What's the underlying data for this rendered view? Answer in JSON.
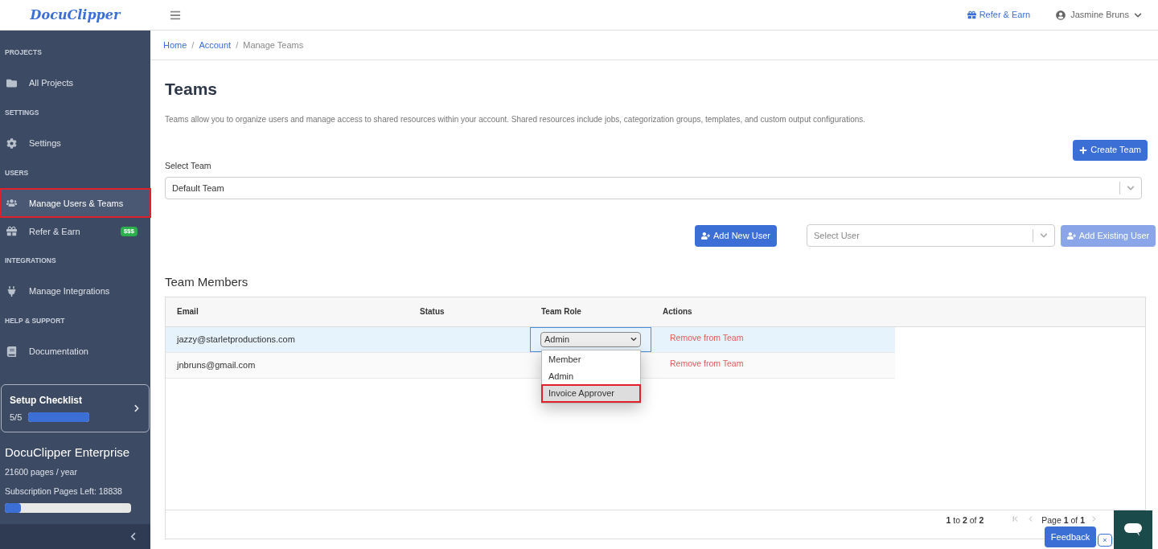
{
  "header": {
    "logo": "DocuClipper",
    "refer_link": "Refer & Earn",
    "user_name": "Jasmine Bruns"
  },
  "sidebar": {
    "sections": [
      {
        "label": "PROJECTS",
        "items": [
          {
            "label": "All Projects",
            "selected": false,
            "outlined": false
          }
        ]
      },
      {
        "label": "SETTINGS",
        "items": [
          {
            "label": "Settings",
            "selected": false,
            "outlined": false
          }
        ]
      },
      {
        "label": "USERS",
        "items": [
          {
            "label": "Manage Users & Teams",
            "selected": true,
            "outlined": true
          },
          {
            "label": "Refer & Earn",
            "selected": false,
            "outlined": false,
            "badge": "$$$"
          }
        ]
      },
      {
        "label": "INTEGRATIONS",
        "items": [
          {
            "label": "Manage Integrations",
            "selected": false,
            "outlined": false
          }
        ]
      },
      {
        "label": "HELP & SUPPORT",
        "items": [
          {
            "label": "Documentation",
            "selected": false,
            "outlined": false
          }
        ]
      }
    ],
    "checklist": {
      "title": "Setup Checklist",
      "count": "5/5",
      "level": 1
    },
    "plan": {
      "name": "DocuClipper Enterprise",
      "pages": "21600 pages / year",
      "left": "Subscription Pages Left: 18838",
      "level": 0.13
    }
  },
  "breadcrumb": [
    {
      "label": "Home",
      "link": true
    },
    {
      "label": "/",
      "separator": true
    },
    {
      "label": "Account",
      "link": true
    },
    {
      "label": "/",
      "separator": true
    },
    {
      "label": "Manage Teams",
      "link": false
    }
  ],
  "page": {
    "title": "Teams",
    "description": "Teams allow you to organize users and manage access to shared resources within your account. Shared resources include jobs, categorization groups, templates, and custom output configurations.",
    "create_button": "Create Team",
    "select_label": "Select Team",
    "select_value": "Default Team",
    "add_new_button": "Add New User",
    "user_select_placeholder": "Select User",
    "add_existing_button": {
      "label": "Add Existing User",
      "disabled": true
    }
  },
  "table": {
    "title": "Team Members",
    "columns": [
      "Email",
      "Status",
      "Team Role",
      "Actions"
    ],
    "rows": [
      {
        "email": "jazzy@starletproductions.com",
        "role": "Admin",
        "action": "Remove from Team",
        "selected": true
      },
      {
        "email": "jnbruns@gmail.com",
        "action": "Remove from Team",
        "selected": false
      }
    ],
    "role_menu": [
      {
        "label": "Member",
        "hovered": false,
        "outlined": false
      },
      {
        "label": "Admin",
        "hovered": false,
        "outlined": false
      },
      {
        "label": "Invoice Approver",
        "hovered": true,
        "outlined": true
      }
    ],
    "summary": "**1** to **2** of **2**",
    "page_info": "Page **1** of **1**"
  },
  "feedback": {
    "label": "Feedback",
    "close": "×"
  }
}
